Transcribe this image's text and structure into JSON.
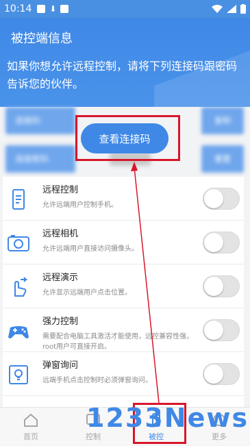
{
  "status_bar": {
    "time": "10:14"
  },
  "header": {
    "title": "被控端信息",
    "description": "如果你想允许远程控制，请将下列连接码跟密码告诉您的伙伴。"
  },
  "codes": {
    "connect_label": "连接码:",
    "password_label": "连接密码:",
    "copy_label": "复制",
    "reset_label": "重置",
    "view_button": "查看连接码"
  },
  "features": [
    {
      "name": "远程控制",
      "desc": "允许远端用户控制手机。",
      "icon": "phone-control-icon",
      "enabled": false
    },
    {
      "name": "远程相机",
      "desc": "允许远端用户直接访问摄像头。",
      "icon": "camera-icon",
      "enabled": false
    },
    {
      "name": "远程演示",
      "desc": "允许显示远端用户点击位置。",
      "icon": "touch-demo-icon",
      "enabled": false
    },
    {
      "name": "强力控制",
      "desc": "需要配合电脑工具激活才能使用，远控兼容性强，root用户可直接开启。",
      "icon": "gamepad-icon",
      "enabled": false
    },
    {
      "name": "弹窗询问",
      "desc": "远端手机点击控制时必须弹窗询问。",
      "icon": "lightbulb-icon",
      "enabled": false
    }
  ],
  "tabs": [
    {
      "label": "首页",
      "icon": "home-icon"
    },
    {
      "label": "控制",
      "icon": "control-icon"
    },
    {
      "label": "被控",
      "icon": "controlled-icon"
    },
    {
      "label": "更多",
      "icon": "more-icon"
    }
  ],
  "watermark": "1233News",
  "colors": {
    "primary": "#3f88e6",
    "highlight": "#d8152a"
  }
}
